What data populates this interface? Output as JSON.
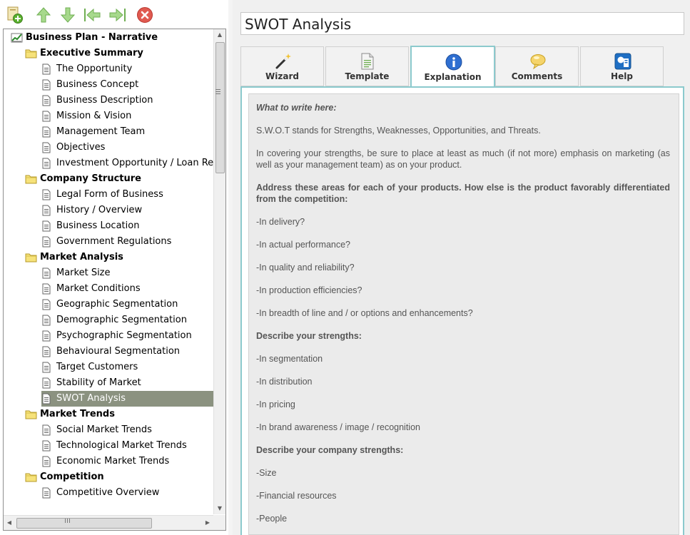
{
  "tree": {
    "root": "Business Plan - Narrative",
    "sections": [
      {
        "label": "Executive Summary",
        "items": [
          "The Opportunity",
          "Business Concept",
          "Business Description",
          "Mission & Vision",
          "Management Team",
          "Objectives",
          "Investment Opportunity / Loan Re"
        ]
      },
      {
        "label": "Company Structure",
        "items": [
          "Legal Form of Business",
          "History / Overview",
          "Business Location",
          "Government Regulations"
        ]
      },
      {
        "label": "Market Analysis",
        "items": [
          "Market Size",
          "Market Conditions",
          "Geographic Segmentation",
          "Demographic Segmentation",
          "Psychographic Segmentation",
          "Behavioural Segmentation",
          "Target Customers",
          "Stability of Market",
          "SWOT Analysis"
        ]
      },
      {
        "label": "Market Trends",
        "items": [
          "Social Market Trends",
          "Technological Market Trends",
          "Economic Market Trends"
        ]
      },
      {
        "label": "Competition",
        "items": [
          "Competitive Overview"
        ]
      }
    ],
    "selected": "SWOT Analysis"
  },
  "title": "SWOT Analysis",
  "tabs": [
    "Wizard",
    "Template",
    "Explanation",
    "Comments",
    "Help"
  ],
  "active_tab": "Explanation",
  "content": [
    {
      "style": "italic",
      "text": "What to write here:"
    },
    {
      "style": "normal",
      "text": "S.W.O.T stands for Strengths, Weaknesses, Opportunities, and Threats."
    },
    {
      "style": "normal",
      "text": "In covering your strengths, be sure to place at least as much (if not more) emphasis on marketing (as well as your management team) as on your product."
    },
    {
      "style": "heading",
      "text": "Address these areas for each of your products. How else is the product favorably differentiated from the competition:"
    },
    {
      "style": "normal",
      "text": "-In delivery?"
    },
    {
      "style": "normal",
      "text": "-In actual performance?"
    },
    {
      "style": "normal",
      "text": "-In quality and reliability?"
    },
    {
      "style": "normal",
      "text": "-In production efficiencies?"
    },
    {
      "style": "normal",
      "text": "-In breadth of line and / or options and enhancements?"
    },
    {
      "style": "heading",
      "text": "Describe your strengths:"
    },
    {
      "style": "normal",
      "text": "-In segmentation"
    },
    {
      "style": "normal",
      "text": "-In distribution"
    },
    {
      "style": "normal",
      "text": "-In pricing"
    },
    {
      "style": "normal",
      "text": "-In brand awareness / image / recognition"
    },
    {
      "style": "heading",
      "text": "Describe your company strengths:"
    },
    {
      "style": "normal",
      "text": "-Size"
    },
    {
      "style": "normal",
      "text": "-Financial resources"
    },
    {
      "style": "normal",
      "text": "-People"
    }
  ],
  "colors": {
    "selected_row": "#8b9280",
    "tab_border": "#8ccacd",
    "content_bg": "#ebebeb"
  }
}
